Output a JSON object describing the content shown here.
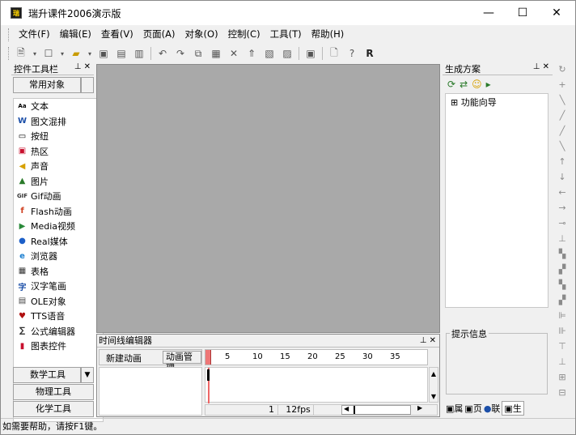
{
  "window": {
    "title": "瑞升课件2006演示版",
    "icon_label": "瑞",
    "min_label": "—",
    "max_label": "☐",
    "close_label": "✕"
  },
  "menu": [
    "文件(F)",
    "编辑(E)",
    "查看(V)",
    "页面(A)",
    "对象(O)",
    "控制(C)",
    "工具(T)",
    "帮助(H)"
  ],
  "left_panel": {
    "title": "控件工具栏",
    "category_top": "常用对象",
    "items": [
      {
        "label": "文本",
        "icon": "text-icon",
        "glyph": "Aa",
        "color": "#000"
      },
      {
        "label": "图文混排",
        "icon": "rich-text-icon",
        "glyph": "W",
        "color": "#1c4fa8"
      },
      {
        "label": "按纽",
        "icon": "button-icon",
        "glyph": "▭",
        "color": "#000"
      },
      {
        "label": "热区",
        "icon": "hotspot-icon",
        "glyph": "▣",
        "color": "#c8102e"
      },
      {
        "label": "声音",
        "icon": "sound-icon",
        "glyph": "◀",
        "color": "#d7a000"
      },
      {
        "label": "图片",
        "icon": "image-icon",
        "glyph": "▲",
        "color": "#2a7a2a"
      },
      {
        "label": "Gif动画",
        "icon": "gif-icon",
        "glyph": "GIF",
        "color": "#333"
      },
      {
        "label": "Flash动画",
        "icon": "flash-icon",
        "glyph": "f",
        "color": "#d04020"
      },
      {
        "label": "Media视频",
        "icon": "media-icon",
        "glyph": "▶",
        "color": "#2a8a3a"
      },
      {
        "label": "Real媒体",
        "icon": "real-icon",
        "glyph": "●",
        "color": "#1c5fc8"
      },
      {
        "label": "浏览器",
        "icon": "browser-icon",
        "glyph": "e",
        "color": "#1c7fd0"
      },
      {
        "label": "表格",
        "icon": "table-icon",
        "glyph": "▦",
        "color": "#333"
      },
      {
        "label": "汉字笔画",
        "icon": "stroke-icon",
        "glyph": "字",
        "color": "#1c4fa8"
      },
      {
        "label": "OLE对象",
        "icon": "ole-icon",
        "glyph": "▤",
        "color": "#444"
      },
      {
        "label": "TTS语音",
        "icon": "tts-icon",
        "glyph": "♥",
        "color": "#b01010"
      },
      {
        "label": "公式编辑器",
        "icon": "formula-icon",
        "glyph": "∑",
        "color": "#333"
      },
      {
        "label": "图表控件",
        "icon": "chart-icon",
        "glyph": "▮",
        "color": "#c8102e"
      }
    ],
    "categories_bottom": [
      "数学工具",
      "物理工具",
      "化学工具"
    ]
  },
  "timeline": {
    "title": "时间线编辑器",
    "new_anim": "新建动画",
    "anim_manage": "动画管理",
    "ticks": [
      "5",
      "10",
      "15",
      "20",
      "25",
      "30",
      "35"
    ],
    "frame": "1",
    "fps": "12fps"
  },
  "right_panel": {
    "title": "生成方案",
    "tree_item": "功能向导",
    "tree_expander": "⊞",
    "info_title": "提示信息",
    "bottom_tabs": [
      "属",
      "页",
      "联",
      "生"
    ]
  },
  "status": "如需要帮助，请按F1键。"
}
